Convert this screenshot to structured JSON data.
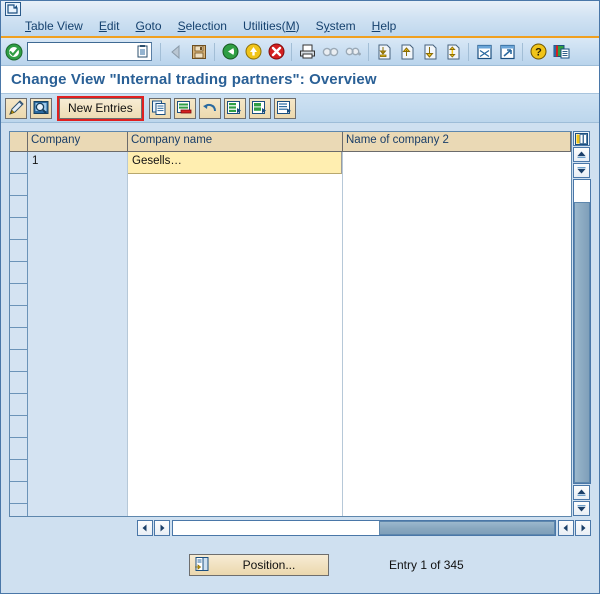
{
  "window": {
    "system_icon": "sap-logo-icon"
  },
  "menu": {
    "items": [
      {
        "label": "Table View",
        "accel": "T",
        "name": "menu-table-view"
      },
      {
        "label": "Edit",
        "accel": "E",
        "name": "menu-edit"
      },
      {
        "label": "Goto",
        "accel": "G",
        "name": "menu-goto"
      },
      {
        "label": "Selection",
        "accel": "S",
        "name": "menu-selection"
      },
      {
        "label": "Utilities(M)",
        "accel": "M",
        "name": "menu-utilities"
      },
      {
        "label": "System",
        "accel": "y",
        "name": "menu-system"
      },
      {
        "label": "Help",
        "accel": "H",
        "name": "menu-help"
      }
    ]
  },
  "toolbar": {
    "enter_icon": "green-check-enter-icon",
    "command_field": {
      "value": "",
      "placeholder": ""
    },
    "command_dropdown_icon": "command-history-icon",
    "buttons": [
      {
        "name": "back-arrow-button",
        "icon": "left-arrow-icon",
        "enabled": false
      },
      {
        "name": "save-button",
        "icon": "floppy-save-icon",
        "enabled": true
      },
      {
        "name": "back-button",
        "icon": "green-back-arrow-icon",
        "enabled": true
      },
      {
        "name": "exit-button",
        "icon": "yellow-up-arrow-exit-icon",
        "enabled": true
      },
      {
        "name": "cancel-button",
        "icon": "red-cross-cancel-icon",
        "enabled": true
      },
      {
        "name": "print-button",
        "icon": "printer-icon",
        "enabled": true
      },
      {
        "name": "find-button",
        "icon": "binoculars-find-icon",
        "enabled": false
      },
      {
        "name": "find-next-button",
        "icon": "binoculars-find-next-icon",
        "enabled": false
      },
      {
        "name": "first-page-button",
        "icon": "first-page-icon",
        "enabled": true
      },
      {
        "name": "previous-page-button",
        "icon": "previous-page-icon",
        "enabled": true
      },
      {
        "name": "next-page-button",
        "icon": "next-page-icon",
        "enabled": true
      },
      {
        "name": "last-page-button",
        "icon": "last-page-icon",
        "enabled": true
      },
      {
        "name": "create-session-button",
        "icon": "create-session-icon",
        "enabled": true
      },
      {
        "name": "create-shortcut-button",
        "icon": "create-shortcut-icon",
        "enabled": true
      },
      {
        "name": "help-button",
        "icon": "yellow-question-help-icon",
        "enabled": true
      },
      {
        "name": "customize-layout-button",
        "icon": "customize-layout-icon",
        "enabled": true
      }
    ]
  },
  "page": {
    "title": "Change View \"Internal trading partners\": Overview"
  },
  "apptoolbar": {
    "display_change_icon": "pencil-display-change-icon",
    "check_icon": "magnifier-check-icon",
    "new_entries_label": "New Entries",
    "new_entries_highlight_color": "#e02020",
    "copy_icon": "copy-as-icon",
    "delete_icon": "delete-row-icon",
    "undo_icon": "undo-change-icon",
    "select_all_icon": "select-all-icon",
    "select_block_icon": "select-block-icon",
    "deselect_icon": "deselect-all-icon"
  },
  "table": {
    "column_config_icon": "table-settings-icon",
    "columns": [
      {
        "label": "Company",
        "name": "column-header-company"
      },
      {
        "label": "Company name",
        "name": "column-header-company-name"
      },
      {
        "label": "Name of company 2",
        "name": "column-header-name-of-company-2"
      }
    ],
    "rows": [
      {
        "company": "1",
        "company_name": "Gesells…",
        "company_name_2": ""
      }
    ],
    "empty_row_count": 15,
    "scroll_up_icon": "scroll-up-icon",
    "scroll_down_icon": "scroll-down-icon",
    "scroll_left_icon": "scroll-left-icon",
    "scroll_right_icon": "scroll-right-icon"
  },
  "footer": {
    "position_icon": "position-icon",
    "position_label": "Position...",
    "entry_status": "Entry 1 of 345"
  },
  "colors": {
    "accent_orange": "#f0a020",
    "title_blue": "#2a6096",
    "window_bg": "#cfe0f0",
    "header_beige": "#ead9b5",
    "cell_yellow": "#ffeeb0",
    "highlight_red": "#e02020"
  }
}
